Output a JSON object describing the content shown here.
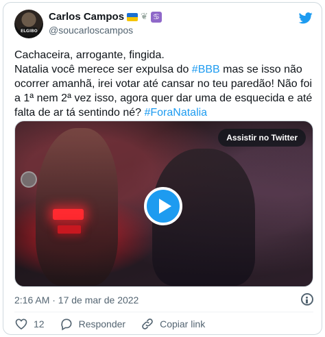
{
  "author": {
    "name": "Carlos Campos",
    "handle": "@soucarloscampos",
    "avatar_text": "ELGIBO",
    "name_emojis": [
      "flag-ukraine",
      "heart-icon",
      "purple-box-icon"
    ],
    "emoji_box_glyph": "♋"
  },
  "tweet": {
    "line1": "Cachaceira, arrogante, fingida.",
    "line2_pre": "Natalia você merece ser expulsa do ",
    "hashtag1": "#BBB",
    "line2_post": " mas se isso não ocorrer amanhã, irei votar até cansar no teu paredão! Não foi a 1ª nem 2ª vez isso, agora quer dar uma de esquecida e até falta de ar tá sentindo né? ",
    "hashtag2": "#ForaNatalia"
  },
  "media": {
    "watch_label": "Assistir no Twitter"
  },
  "meta": {
    "timestamp": "2:16 AM · 17 de mar de 2022"
  },
  "actions": {
    "like_count": "12",
    "reply_label": "Responder",
    "copy_label": "Copiar link"
  },
  "colors": {
    "accent": "#1d9bf0",
    "text": "#0f1419",
    "muted": "#536471",
    "border": "#cfd9de"
  }
}
